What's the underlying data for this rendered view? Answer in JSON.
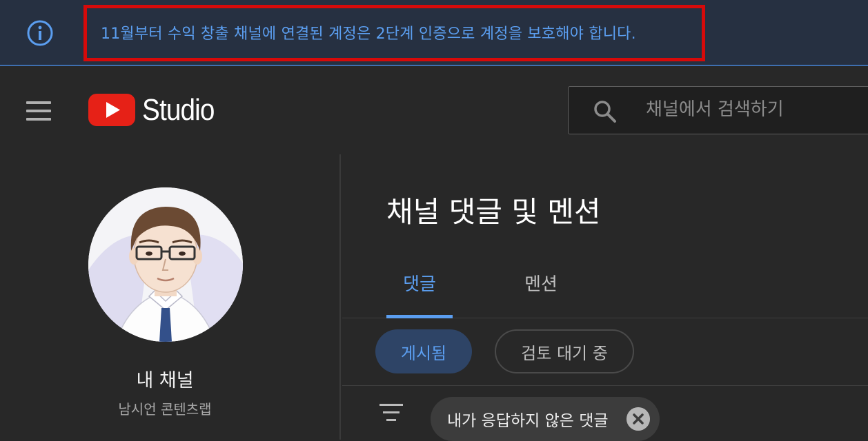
{
  "banner": {
    "message": "11월부터 수익 창출 채널에 연결된 계정은 2단계 인증으로 계정을 보호해야 합니다."
  },
  "header": {
    "logo_text": "Studio",
    "search_placeholder": "채널에서 검색하기"
  },
  "sidebar": {
    "channel_title": "내 채널",
    "channel_name": "남시언 콘텐츠랩"
  },
  "main": {
    "page_title": "채널 댓글 및 멘션",
    "tabs": [
      {
        "label": "댓글",
        "active": true
      },
      {
        "label": "멘션",
        "active": false
      }
    ],
    "chips": [
      {
        "label": "게시됨",
        "selected": true
      },
      {
        "label": "검토 대기 중",
        "selected": false
      }
    ],
    "filter_chip_label": "내가 응답하지 않은 댓글"
  },
  "colors": {
    "accent": "#5b9ef0",
    "banner_bg": "#263041",
    "highlight_border": "#d60a0a",
    "youtube_red": "#e62117",
    "background": "#282828"
  },
  "icons": [
    "info-icon",
    "menu-icon",
    "youtube-play-icon",
    "search-icon",
    "filter-icon",
    "close-icon"
  ]
}
